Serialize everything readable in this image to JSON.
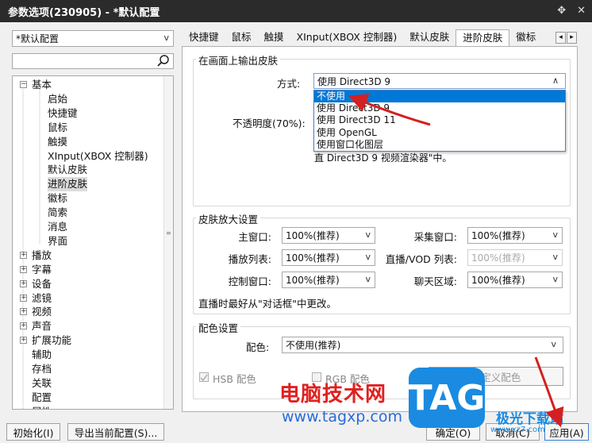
{
  "window": {
    "title": "参数选项(230905) - *默认配置",
    "pin_icon": "✥",
    "close_icon": "✕"
  },
  "profile_select": {
    "value": "*默认配置",
    "arrow": "v"
  },
  "search": {
    "value": "",
    "icon": "search-icon"
  },
  "tree": [
    {
      "label": "基本",
      "expander": "⊟",
      "level": 0
    },
    {
      "label": "启始",
      "level": 1
    },
    {
      "label": "快捷键",
      "level": 1
    },
    {
      "label": "鼠标",
      "level": 1
    },
    {
      "label": "触摸",
      "level": 1
    },
    {
      "label": "XInput(XBOX 控制器)",
      "level": 1
    },
    {
      "label": "默认皮肤",
      "level": 1
    },
    {
      "label": "进阶皮肤",
      "level": 1,
      "selected": true
    },
    {
      "label": "徽标",
      "level": 1
    },
    {
      "label": "简索",
      "level": 1
    },
    {
      "label": "消息",
      "level": 1
    },
    {
      "label": "界面",
      "level": 1
    },
    {
      "label": "播放",
      "expander": "⊞",
      "level": 0
    },
    {
      "label": "字幕",
      "expander": "⊞",
      "level": 0
    },
    {
      "label": "设备",
      "expander": "⊞",
      "level": 0
    },
    {
      "label": "滤镜",
      "expander": "⊞",
      "level": 0
    },
    {
      "label": "视频",
      "expander": "⊞",
      "level": 0
    },
    {
      "label": "声音",
      "expander": "⊞",
      "level": 0
    },
    {
      "label": "扩展功能",
      "expander": "⊞",
      "level": 0
    },
    {
      "label": "辅助",
      "level": 0
    },
    {
      "label": "存档",
      "level": 0
    },
    {
      "label": "关联",
      "level": 0
    },
    {
      "label": "配置",
      "level": 0
    },
    {
      "label": "属性",
      "level": 0
    }
  ],
  "tabs": [
    {
      "label": "快捷键"
    },
    {
      "label": "鼠标"
    },
    {
      "label": "触摸"
    },
    {
      "label": "XInput(XBOX 控制器)"
    },
    {
      "label": "默认皮肤"
    },
    {
      "label": "进阶皮肤",
      "active": true
    },
    {
      "label": "徽标"
    }
  ],
  "tab_nav": {
    "left": "◂",
    "right": "▸"
  },
  "output_group": {
    "title": "在画面上输出皮肤",
    "method_label": "方式:",
    "method_value": "使用 Direct3D 9",
    "method_arrow": "∧",
    "opacity_label": "不透明度(70%):",
    "hint_text": "直 Direct3D 9 视频渲染器\"中。",
    "options": [
      "不使用",
      "使用 Direct3D 9",
      "使用 Direct3D 11",
      "使用 OpenGL",
      "使用窗口化图层"
    ],
    "highlighted_index": 0
  },
  "zoom_group": {
    "title": "皮肤放大设置",
    "rows": [
      {
        "left_label": "主窗口:",
        "left_value": "100%(推荐)",
        "right_label": "采集窗口:",
        "right_value": "100%(推荐)",
        "right_disabled": false
      },
      {
        "left_label": "播放列表:",
        "left_value": "100%(推荐)",
        "right_label": "直播/VOD 列表:",
        "right_value": "100%(推荐)",
        "right_disabled": true
      },
      {
        "left_label": "控制窗口:",
        "left_value": "100%(推荐)",
        "right_label": "聊天区域:",
        "right_value": "100%(推荐)",
        "right_disabled": false
      }
    ],
    "note": "直播时最好从\"对话框\"中更改。"
  },
  "color_group": {
    "title": "配色设置",
    "label": "配色:",
    "value": "不使用(推荐)",
    "hsb_label": "HSB 配色",
    "rgb_label": "RGB 配色",
    "custom_button": "自定义配色"
  },
  "bottom_buttons": {
    "init": "初始化(I)",
    "export": "导出当前配置(S)...",
    "ok": "确定(O)",
    "cancel": "取消(C)",
    "apply": "应用(A)"
  },
  "watermark": {
    "brand_cn": "电脑技术网",
    "url": "www.tagxp.com",
    "tag": "TAG",
    "side_cn": "极光下载站",
    "side_url": "www.xz7.com"
  },
  "colors": {
    "accent": "#0078d7",
    "arrow": "#d42020",
    "title_bg": "#2b2b2b"
  }
}
